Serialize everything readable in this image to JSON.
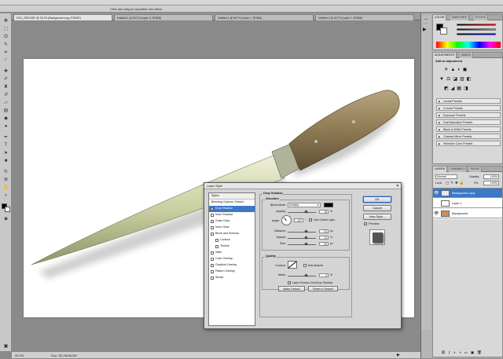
{
  "app": {
    "optionbar_hint": "Click and drag to reposition the effect."
  },
  "tabs": [
    {
      "label": "DSC_2992.NEF @ 33,3% (Background copy, RGB/8*)"
    },
    {
      "label": "Untitled-1 @ 66,7% (Layer 3, RGB/8)"
    },
    {
      "label": "Untitled-1 @ 66,7% (Layer 1, RGB/8)"
    },
    {
      "label": "Untitled-1 @ 66,7% (Layer 1, RGB/8)"
    }
  ],
  "status": {
    "zoom": "33,3%",
    "doc": "Doc: 28,7M/46,0M"
  },
  "panels": {
    "color_tabs": [
      "COLOR",
      "SWATCHES",
      "STYLES"
    ],
    "adjustments_tabs": [
      "ADJUSTMENTS",
      "MASKS"
    ],
    "adjustments_title": "Add an adjustment",
    "presets": [
      "Levels Presets",
      "Curves Presets",
      "Exposure Presets",
      "Hue/Saturation Presets",
      "Black & White Presets",
      "Channel Mixer Presets",
      "Selective Color Presets"
    ],
    "layers_tabs": [
      "LAYERS",
      "CHANNELS",
      "PATHS"
    ],
    "blend": "Normal",
    "opacity_label": "Opacity:",
    "opacity": "100%",
    "lock_label": "Lock:",
    "fill_label": "Fill:",
    "fill": "100%",
    "layers": [
      {
        "name": "Background copy",
        "selected": true
      },
      {
        "name": "Layer 1",
        "selected": false
      },
      {
        "name": "Background",
        "selected": false
      }
    ]
  },
  "dialog": {
    "title": "Layer Style",
    "styles": [
      {
        "label": "Styles",
        "type": "header"
      },
      {
        "label": "Blending Options: Default",
        "type": "plain"
      },
      {
        "label": "Drop Shadow",
        "type": "check",
        "checked": true,
        "selected": true
      },
      {
        "label": "Inner Shadow",
        "type": "check",
        "checked": false
      },
      {
        "label": "Outer Glow",
        "type": "check",
        "checked": false
      },
      {
        "label": "Inner Glow",
        "type": "check",
        "checked": false
      },
      {
        "label": "Bevel and Emboss",
        "type": "check",
        "checked": false
      },
      {
        "label": "Contour",
        "type": "check-indent",
        "checked": false
      },
      {
        "label": "Texture",
        "type": "check-indent",
        "checked": false
      },
      {
        "label": "Satin",
        "type": "check",
        "checked": false
      },
      {
        "label": "Color Overlay",
        "type": "check",
        "checked": false
      },
      {
        "label": "Gradient Overlay",
        "type": "check",
        "checked": false
      },
      {
        "label": "Pattern Overlay",
        "type": "check",
        "checked": false
      },
      {
        "label": "Stroke",
        "type": "check",
        "checked": false
      }
    ],
    "section_title": "Drop Shadow",
    "structure_label": "Structure",
    "blend_mode_label": "Blend Mode:",
    "blend_mode": "Multiply",
    "opacity_label": "Opacity:",
    "opacity": "75",
    "angle_label": "Angle:",
    "angle": "127",
    "global_light_label": "Use Global Light",
    "distance_label": "Distance:",
    "distance": "31",
    "spread_label": "Spread:",
    "spread": "11",
    "size_label": "Size:",
    "size": "29",
    "percent": "%",
    "px": "px",
    "degree": "°",
    "quality_label": "Quality",
    "contour_label": "Contour:",
    "anti_alias_label": "Anti-aliased",
    "noise_label": "Noise:",
    "noise": "0",
    "knockout_label": "Layer Knocks Out Drop Shadow",
    "make_default": "Make Default",
    "reset_default": "Reset to Default",
    "ok": "OK",
    "cancel": "Cancel",
    "new_style": "New Style...",
    "preview": "Preview"
  },
  "colors": {
    "selection": "#3b78c8",
    "knife_blade": "#c9cfa0",
    "knife_handle": "#8e7a54"
  }
}
